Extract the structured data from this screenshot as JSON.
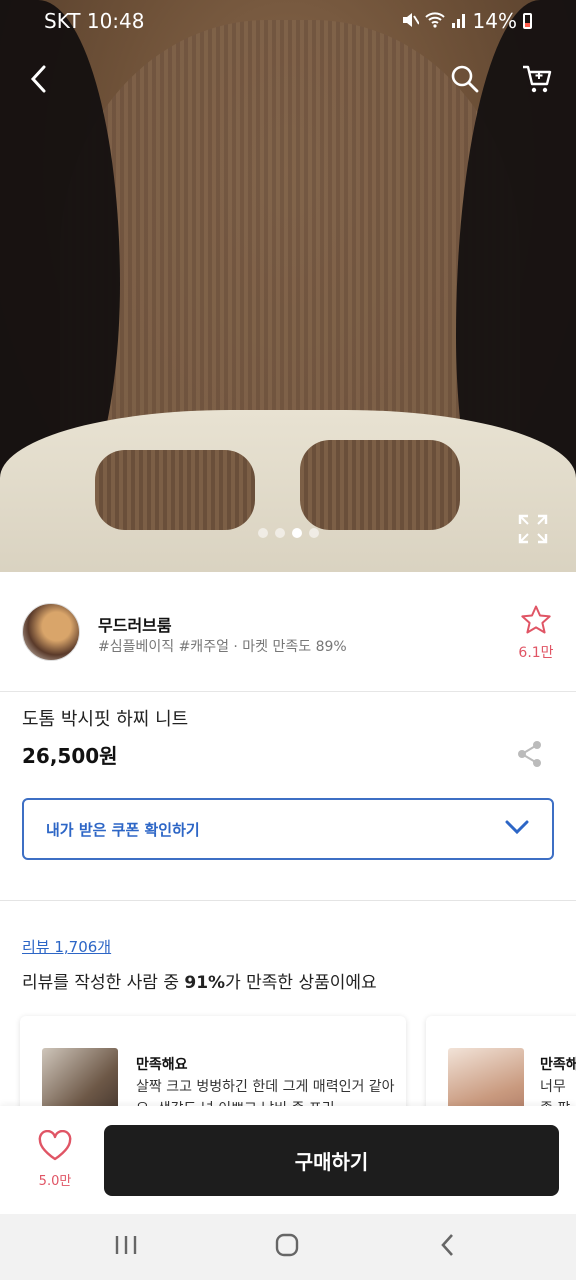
{
  "status_bar": {
    "carrier": "SKT",
    "time": "10:48",
    "battery": "14%"
  },
  "hero": {
    "page_count": 4,
    "active_page": 3
  },
  "seller": {
    "name": "무드러브룸",
    "tags": "#심플베이직 #캐주얼 · 마켓 만족도 89%",
    "favorite_count": "6.1만"
  },
  "product": {
    "name": "도톰 박시핏 하찌 니트",
    "price": "26,500원"
  },
  "coupon": {
    "label": "내가 받은 쿠폰 확인하기"
  },
  "reviews": {
    "link": "리뷰 1,706개",
    "summary_prefix": "리뷰를 작성한 사람 중 ",
    "summary_percent": "91%",
    "summary_suffix": "가 만족한 상품이에요",
    "cards": [
      {
        "title": "만족해요",
        "text": "살짝 크고 벙벙하긴 한데 그게 매력인거 같아요. 색감도 넘 이쁘고 남비 좀 프리..."
      },
      {
        "title": "만족해",
        "text": "너무 좋 팜팜팜"
      }
    ]
  },
  "buy_bar": {
    "like_count": "5.0만",
    "buy_label": "구매하기"
  },
  "colors": {
    "accent_blue": "#2d66c6",
    "like_red": "#e05565",
    "buy_button": "#1d1d1d"
  }
}
